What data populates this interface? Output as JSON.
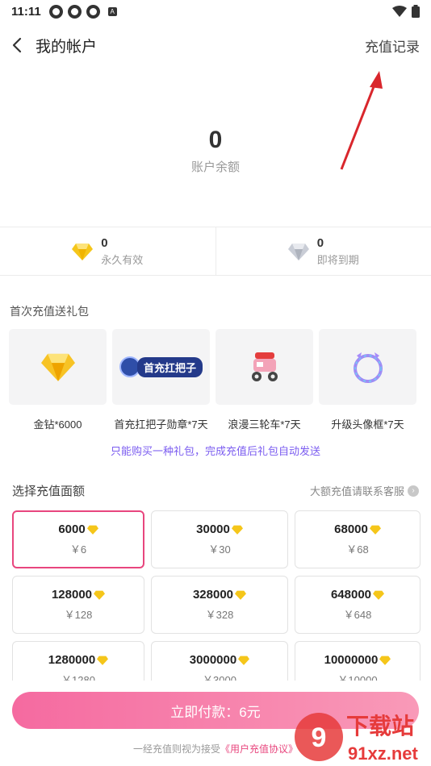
{
  "status_bar": {
    "time": "11:11"
  },
  "header": {
    "title": "我的帐户",
    "right_link": "充值记录"
  },
  "balance": {
    "value": "0",
    "label": "账户余额"
  },
  "gems": [
    {
      "count": "0",
      "desc": "永久有效",
      "color": "#f5c61a"
    },
    {
      "count": "0",
      "desc": "即将到期",
      "color": "#c9cdd6"
    }
  ],
  "gift": {
    "title": "首次充值送礼包",
    "items": [
      {
        "label": "金钻*6000",
        "icon": "gold-diamond-icon"
      },
      {
        "label": "首充扛把子勋章*7天",
        "icon": "medal-badge-icon",
        "badge_text": "首充扛把子"
      },
      {
        "label": "浪漫三轮车*7天",
        "icon": "tricycle-icon"
      },
      {
        "label": "升级头像框*7天",
        "icon": "avatar-frame-icon"
      }
    ],
    "note": "只能购买一种礼包，完成充值后礼包自动发送"
  },
  "recharge": {
    "title": "选择充值面额",
    "contact": "大额充值请联系客服",
    "options": [
      {
        "amount": "6000",
        "price": "￥6",
        "selected": true
      },
      {
        "amount": "30000",
        "price": "￥30"
      },
      {
        "amount": "68000",
        "price": "￥68"
      },
      {
        "amount": "128000",
        "price": "￥128"
      },
      {
        "amount": "328000",
        "price": "￥328"
      },
      {
        "amount": "648000",
        "price": "￥648"
      },
      {
        "amount": "1280000",
        "price": "￥1280"
      },
      {
        "amount": "3000000",
        "price": "￥3000"
      },
      {
        "amount": "10000000",
        "price": "￥10000"
      }
    ]
  },
  "pay": {
    "button": "立即付款：6元"
  },
  "agreement": {
    "prefix": "一经充值则视为接受",
    "link": "《用户充值协议》"
  },
  "watermark": {
    "brand": "下载站",
    "url": "91xz.net"
  },
  "colors": {
    "accent": "#e8467e",
    "note": "#7b5cf0",
    "gold": "#f5c61a",
    "arrow": "#d9262c"
  }
}
